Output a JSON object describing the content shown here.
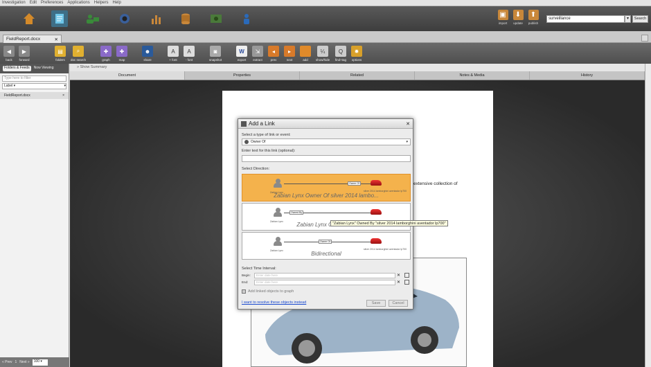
{
  "menubar": [
    "Investigation",
    "Edit",
    "Preferences",
    "Applications",
    "Helpers",
    "Help"
  ],
  "top_right": {
    "import": "import",
    "update": "update",
    "publish": "publish"
  },
  "search": {
    "value": "surveillance",
    "button": "Search"
  },
  "doc_tab": {
    "label": "FieldReport.docx",
    "close": "✕"
  },
  "toolbar": [
    "back",
    "forward",
    "folders",
    "doc search",
    "graph",
    "map",
    "share",
    "+ font",
    "- font",
    "snapshot",
    "export",
    "extract",
    "prev",
    "next",
    "add",
    "show/hide",
    "find+tag",
    "options"
  ],
  "left_panel": {
    "tabs": [
      "Folders & Feeds",
      "Now Viewing"
    ],
    "filter_placeholder": "Type here to filter",
    "label_select": "Label ▾",
    "item": "FieldReport.docx",
    "footer": {
      "prev": "« Prev",
      "page": "1",
      "next": "Next »",
      "size": "100 ▾"
    }
  },
  "summary_link": "» Show Summary",
  "doc_tabs": [
    "Document",
    "Properties",
    "Related",
    "Notes & Media",
    "History"
  ],
  "page_text": "extensive collection of",
  "dialog": {
    "title": "Add a Link",
    "type_label": "Select a type of link or event:",
    "type_value": "Owner Of",
    "text_label": "Enter text for this link (optional):",
    "direction_label": "Select Direction:",
    "directions": [
      {
        "caption": "Zabian Lynx Owner Of silver 2014 lambo...",
        "left": "Zabian Lynx",
        "link": "Owner Of",
        "right": "silver 2014 lamborghini aventador lp700"
      },
      {
        "caption": "Zabian Lynx Owned B...",
        "left": "Zabian Lynx",
        "link": "Owned By",
        "right": "silver 2014 lamborghini aventador lp700"
      },
      {
        "caption": "Bidirectional",
        "left": "Zabian Lynx",
        "link": "Owner Of",
        "right": "silver 2014 lamborghini aventador lp700"
      }
    ],
    "time_label": "Select Time Interval:",
    "begin_label": "Begin:",
    "end_label": "End:",
    "date_placeholder": "Enter date here",
    "add_linked": "Add linked objects to graph",
    "resolve_link": "I want to resolve these objects instead",
    "save": "Save",
    "cancel": "Cancel"
  },
  "tooltip": "\"Zabian Lynx\" Owned By \"silver 2014 lamborghini aventador lp700\""
}
